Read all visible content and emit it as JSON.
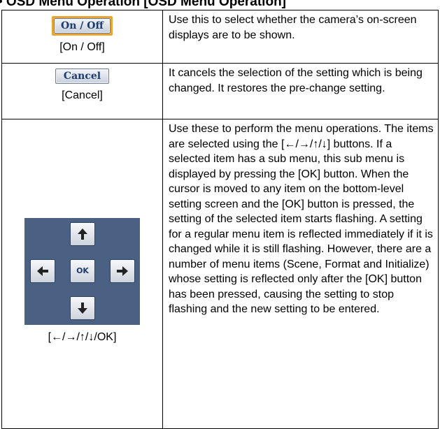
{
  "heading": "• OSD Menu Operation [OSD Menu Operation]",
  "rows": [
    {
      "button_label": "On / Off",
      "caption": "[On / Off]",
      "description": "Use this to select whether the camera’s on-screen displays are to be shown."
    },
    {
      "button_label": "Cancel",
      "caption": "[Cancel]",
      "description": "It cancels the selection of the setting which is being changed. It restores the pre-change setting."
    },
    {
      "buttons": {
        "ok_label": "OK",
        "up_icon": "arrow-up-icon",
        "down_icon": "arrow-down-icon",
        "left_icon": "arrow-left-icon",
        "right_icon": "arrow-right-icon"
      },
      "caption": "[←/→/↑/↓/OK]",
      "description": "Use these to perform the menu operations. The items are selected using the [←/→/↑/↓] buttons. If a selected item has a sub menu, this sub menu is displayed by pressing the [OK] button. When the cursor is moved to any item on the bottom-level setting screen and the [OK] button is pressed, the setting of the selected item starts flashing. A setting for a regular menu item is reflected immediately if it is changed while it is still flashing. However, there are a number of menu items (Scene, Format and Initialize) whose setting is reflected only after the [OK] button has been pressed, causing the setting to stop flashing and the new setting to be entered."
    }
  ],
  "colors": {
    "pad_bg": "#4a6183",
    "onoff_highlight": "#e9a534",
    "button_text": "#1c3b70"
  }
}
